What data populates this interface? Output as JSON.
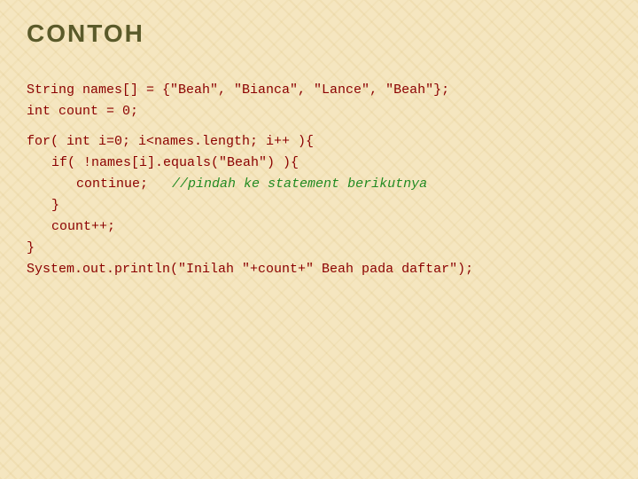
{
  "slide": {
    "title": "CONTOH",
    "background_color": "#f5e6c0",
    "code": {
      "lines": [
        {
          "id": "line1",
          "text": "String names[] = {\"Beah\", \"Bianca\", \"Lance\", \"Beah\"};",
          "indent": 0
        },
        {
          "id": "line2",
          "text": "int count = 0;",
          "indent": 0
        },
        {
          "id": "empty1",
          "text": "",
          "indent": 0
        },
        {
          "id": "line3",
          "text": "for( int i=0; i<names.length; i++ ){",
          "indent": 0
        },
        {
          "id": "line4",
          "text": "    if( !names[i].equals(\"Beah\") ){",
          "indent": 0
        },
        {
          "id": "line5_pre",
          "text": "        continue;   ",
          "indent": 0
        },
        {
          "id": "line5_comment",
          "text": "//pindah ke statement berikutnya",
          "indent": 0
        },
        {
          "id": "line6",
          "text": "    }",
          "indent": 0
        },
        {
          "id": "line7",
          "text": "    count++;",
          "indent": 0
        },
        {
          "id": "line8",
          "text": "}",
          "indent": 0
        },
        {
          "id": "line9",
          "text": "System.out.println(“Inilah \"+count+\" Beah pada daftar\");",
          "indent": 0
        }
      ]
    }
  }
}
